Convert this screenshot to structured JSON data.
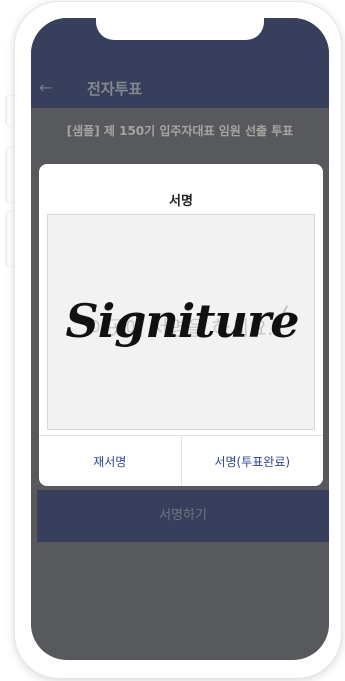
{
  "appbar": {
    "back_icon": "arrow-left-icon",
    "title": "전자투표"
  },
  "vote": {
    "subtitle": "[샘플] 제 150기 입주자대표 임원 선출 투표",
    "submit_label": "서명하기"
  },
  "modal": {
    "title": "서명",
    "placeholder": "이곳에 서명을 하세요.",
    "signature_text": "Signiture",
    "pen_icon": "pen-icon",
    "resign_label": "재서명",
    "confirm_label": "서명(투표완료)"
  },
  "colors": {
    "appbar": "#2b3a6b",
    "accent_text": "#2f4691",
    "screen_bg": "#65686c"
  }
}
